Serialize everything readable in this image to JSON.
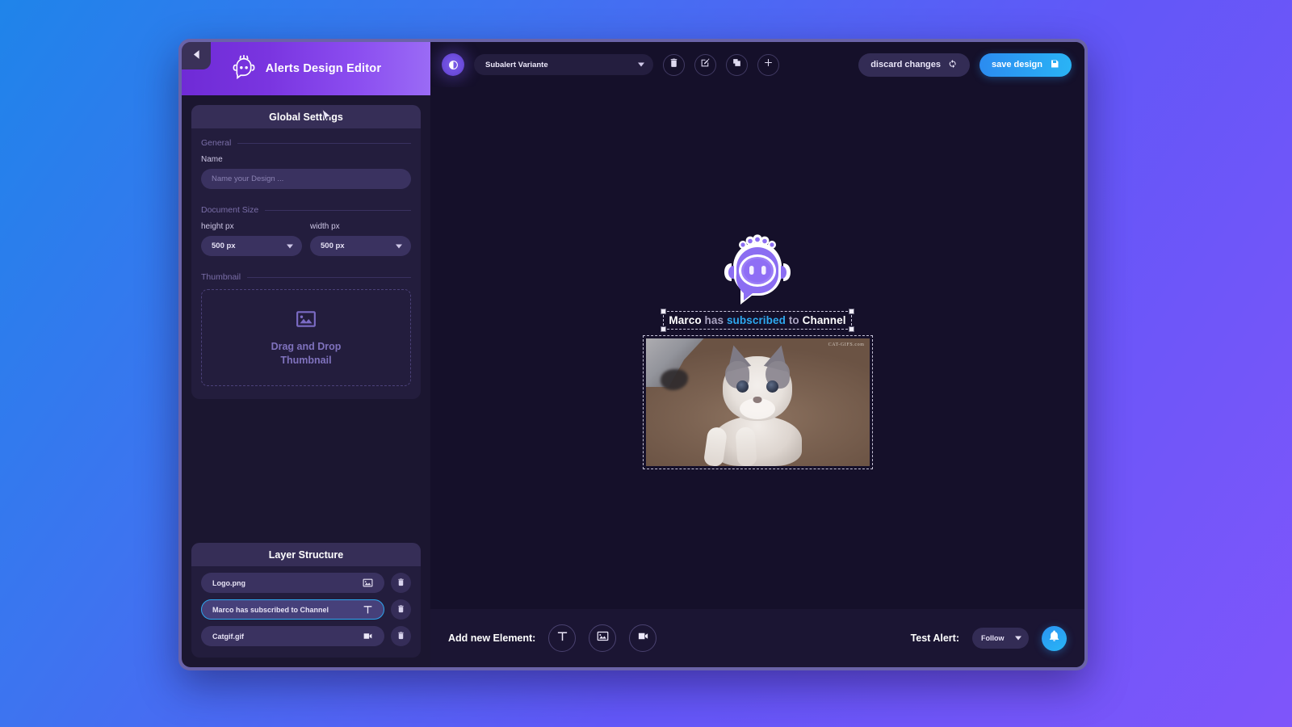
{
  "app": {
    "brand_title": "Alerts Design Editor",
    "collapse_icon": "chevron-left-icon",
    "logo_icon": "robot-chat-logo-icon"
  },
  "sidebar": {
    "global_settings": {
      "panel_title": "Global Settings",
      "sections": {
        "general": {
          "heading": "General",
          "name_label": "Name",
          "name_value": "",
          "name_placeholder": "Name your Design ..."
        },
        "document_size": {
          "heading": "Document Size",
          "height_label": "height px",
          "height_value": "500 px",
          "width_label": "width px",
          "width_value": "500 px"
        },
        "thumbnail": {
          "heading": "Thumbnail",
          "dropzone_icon": "image-icon",
          "dropzone_line1": "Drag and Drop",
          "dropzone_line2": "Thumbnail"
        }
      }
    },
    "layer_structure": {
      "panel_title": "Layer Structure",
      "layers": [
        {
          "name": "Logo.png",
          "type_icon": "image-icon",
          "selected": false,
          "delete_icon": "trash-icon"
        },
        {
          "name": "Marco has subscribed to Channel",
          "type_icon": "text-icon",
          "selected": true,
          "delete_icon": "trash-icon"
        },
        {
          "name": "Catgif.gif",
          "type_icon": "video-icon",
          "selected": false,
          "delete_icon": "trash-icon"
        }
      ]
    }
  },
  "editor": {
    "toolbar": {
      "contrast_icon": "contrast-toggle-icon",
      "variant_selected": "Subalert Variante",
      "variant_caret_icon": "chevron-down-icon",
      "actions": [
        {
          "name": "delete-variant",
          "icon": "trash-icon"
        },
        {
          "name": "rename-variant",
          "icon": "edit-pencil-icon"
        },
        {
          "name": "duplicate-variant",
          "icon": "duplicate-icon"
        },
        {
          "name": "add-variant",
          "icon": "plus-icon"
        }
      ],
      "discard_label": "discard changes",
      "discard_icon": "refresh-icon",
      "save_label": "save design",
      "save_icon": "floppy-save-icon"
    },
    "canvas": {
      "logo_layer": {
        "name": "Logo.png",
        "icon": "robot-mascot-logo"
      },
      "text_layer": {
        "selected": true,
        "segments": [
          {
            "text": "Marco",
            "color": "#ffffff"
          },
          {
            "text": " has ",
            "color": "#a9a3c0"
          },
          {
            "text": "subscribed",
            "color": "#2ea9ef"
          },
          {
            "text": " to ",
            "color": "#a9a3c0"
          },
          {
            "text": "Channel",
            "color": "#ffffff"
          }
        ],
        "full_text": "Marco has subscribed to Channel"
      },
      "gif_layer": {
        "name": "Catgif.gif",
        "watermark": "CAT-GIFS.com"
      }
    },
    "bottom_bar": {
      "add_label": "Add new Element:",
      "add_buttons": [
        {
          "name": "add-text-element",
          "icon": "text-icon"
        },
        {
          "name": "add-image-element",
          "icon": "image-icon"
        },
        {
          "name": "add-video-element",
          "icon": "video-icon"
        }
      ],
      "test_label": "Test Alert:",
      "test_selected": "Follow",
      "test_caret_icon": "chevron-down-icon",
      "bell_icon": "bell-icon"
    }
  },
  "colors": {
    "accent_blue": "#2ea9ef",
    "accent_purple": "#7b5de8",
    "sidebar_header_purple": "#7a35e0",
    "save_gradient_from": "#2b8bf0",
    "save_gradient_to": "#2ab4f5",
    "background_from": "#1f84ea",
    "background_to": "#7f55fa"
  }
}
